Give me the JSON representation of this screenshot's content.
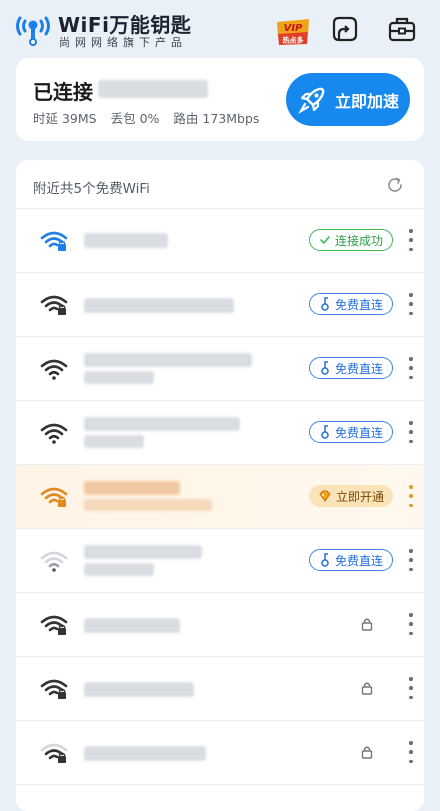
{
  "header": {
    "brand_title": "WiFi万能钥匙",
    "brand_subtitle": "尚网网络旗下产品",
    "vip_label": "VIP",
    "vip_sub": "热点多",
    "icons": [
      "logo-icon",
      "vip-badge-icon",
      "scan-icon",
      "toolbox-icon"
    ]
  },
  "status": {
    "connected_prefix": "已连接",
    "latency_label": "时延 39MS",
    "loss_label": "丢包 0%",
    "route_label": "路由 173Mbps",
    "boost_label": "立即加速"
  },
  "list": {
    "title": "附近共5个免费WiFi",
    "items": [
      {
        "signal": "connected",
        "badge_type": "green",
        "badge": "连接成功"
      },
      {
        "signal": "lock",
        "badge_type": "blue",
        "badge": "免费直连"
      },
      {
        "signal": "open",
        "badge_type": "blue",
        "badge": "免费直连"
      },
      {
        "signal": "open",
        "badge_type": "blue",
        "badge": "免费直连"
      },
      {
        "signal": "orange-lock",
        "badge_type": "orange",
        "badge": "立即开通"
      },
      {
        "signal": "weak",
        "badge_type": "blue",
        "badge": "免费直连"
      },
      {
        "signal": "lock",
        "badge_type": "lock",
        "badge": ""
      },
      {
        "signal": "lock",
        "badge_type": "lock",
        "badge": ""
      },
      {
        "signal": "lock",
        "badge_type": "lock",
        "badge": ""
      }
    ]
  },
  "colors": {
    "accent": "#1688ee",
    "success": "#3fb85b",
    "vip": "#f0a21b"
  }
}
